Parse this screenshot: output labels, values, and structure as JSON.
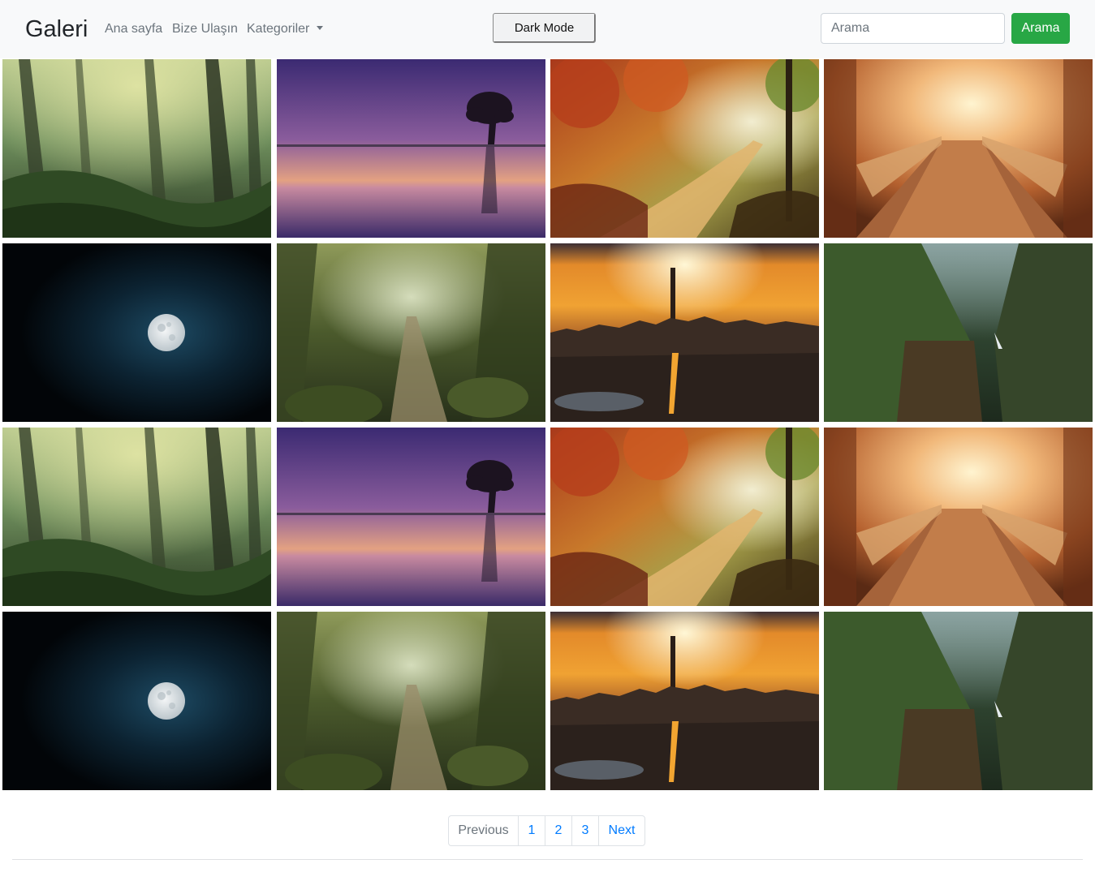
{
  "navbar": {
    "brand": "Galeri",
    "links": [
      "Ana sayfa",
      "Bize Ulaşın"
    ],
    "dropdown_label": "Kategoriler",
    "dark_mode_label": "Dark Mode",
    "search": {
      "placeholder": "Arama",
      "value": "",
      "button_label": "Arama"
    }
  },
  "gallery": {
    "columns": 4,
    "rows": 4,
    "images": [
      "misty-forest",
      "purple-lake-tree",
      "autumn-path",
      "light-bridge",
      "full-moon",
      "forest-trail",
      "city-sunset",
      "green-canyon",
      "misty-forest",
      "purple-lake-tree",
      "autumn-path",
      "light-bridge",
      "full-moon",
      "forest-trail",
      "city-sunset",
      "green-canyon"
    ]
  },
  "pagination": {
    "previous_label": "Previous",
    "pages": [
      "1",
      "2",
      "3"
    ],
    "next_label": "Next"
  },
  "colors": {
    "navbar_bg": "#f8f9fa",
    "search_button": "#28a745",
    "link_active": "#007bff"
  }
}
